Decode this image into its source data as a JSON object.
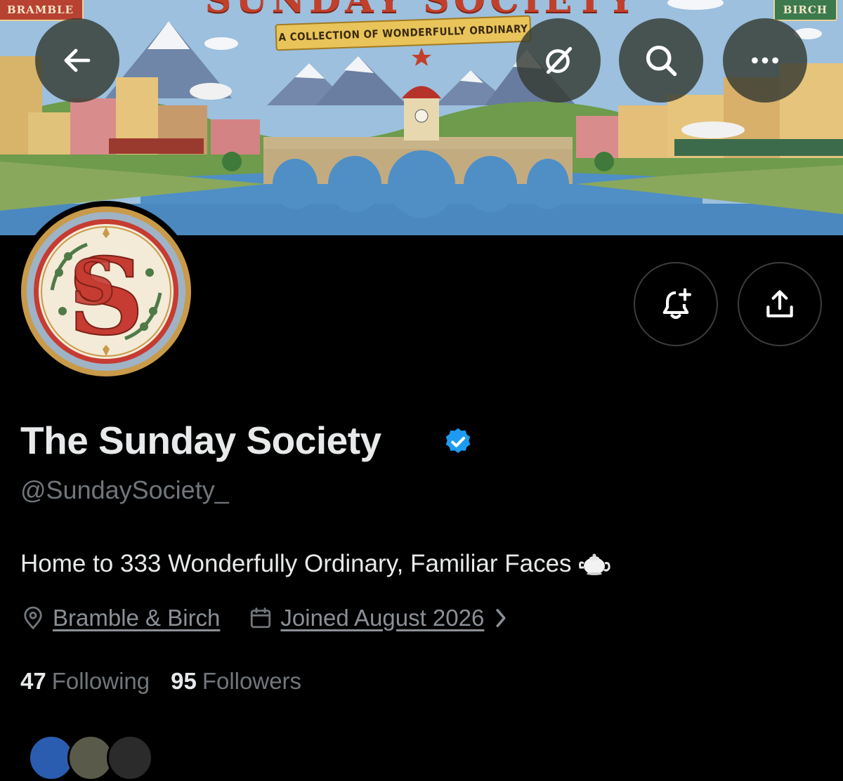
{
  "banner": {
    "title": "SUNDAY SOCIETY",
    "subtitle": "A COLLECTION OF WONDERFULLY ORDINARY",
    "left_tag": "BRAMBLE",
    "right_tag": "BIRCH"
  },
  "header": {
    "back_icon": "arrow-left-icon",
    "grok_icon": "grok-slash-icon",
    "search_icon": "search-icon",
    "more_icon": "more-horizontal-icon"
  },
  "avatar": {
    "monogram": "SS"
  },
  "actions": {
    "notify_icon": "bell-plus-icon",
    "share_icon": "share-upload-icon"
  },
  "profile": {
    "display_name": "The Sunday Society",
    "verified": true,
    "verified_color": "#1d9bf0",
    "handle": "@SundaySociety_",
    "bio": "Home to 333 Wonderfully Ordinary, Familiar Faces",
    "bio_emoji": "teapot-icon",
    "location": "Bramble & Birch",
    "joined": "Joined August 2026"
  },
  "stats": {
    "following_count": "47",
    "following_label": "Following",
    "followers_count": "95",
    "followers_label": "Followers"
  },
  "colors": {
    "background": "#000000",
    "text_primary": "#e7e9ea",
    "text_secondary": "#71767b",
    "accent": "#1d9bf0"
  }
}
